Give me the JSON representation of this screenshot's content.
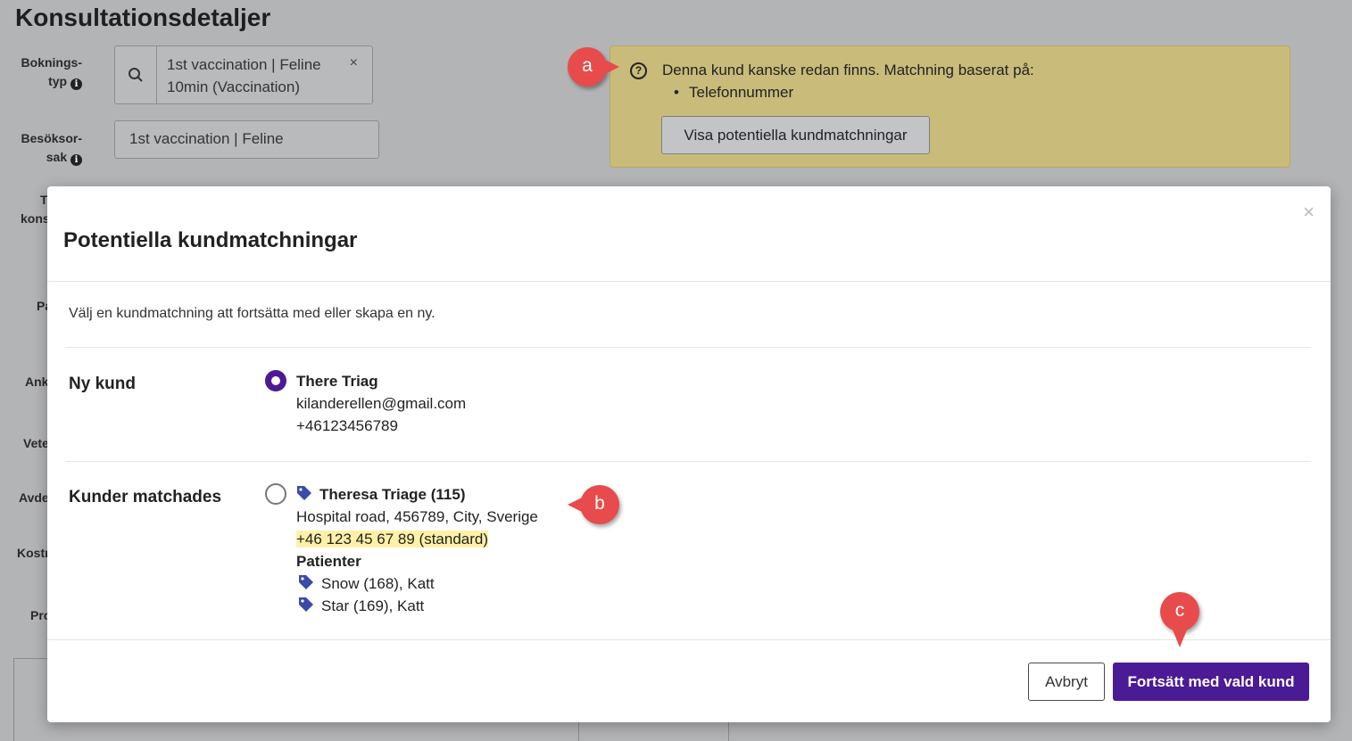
{
  "page": {
    "title": "Konsultationsdetaljer",
    "booking_type_label": [
      "Boknings-",
      "typ"
    ],
    "booking_type_value": [
      "1st vaccination | Feline",
      "10min (Vaccination)"
    ],
    "visit_reason_label": [
      "Besöksor-",
      "sak"
    ],
    "visit_reason_value": "1st vaccination | Feline",
    "cut_labels": [
      "T",
      "kons",
      "Pa",
      "Ank",
      "Vete",
      "Avde",
      "Kostr",
      "Pro"
    ]
  },
  "warning": {
    "text": "Denna kund kanske redan finns. Matchning baserat på:",
    "bullet": "Telefonnummer",
    "button": "Visa potentiella kundmatchningar"
  },
  "callouts": {
    "a": "a",
    "b": "b",
    "c": "c"
  },
  "modal": {
    "title": "Potentiella kundmatchningar",
    "close": "×",
    "intro": "Välj en kundmatchning att fortsätta med eller skapa en ny.",
    "new_customer": {
      "label": "Ny kund",
      "name": "There Triag",
      "email": "kilanderellen@gmail.com",
      "phone": "+46123456789",
      "selected": true
    },
    "matched": {
      "label": "Kunder matchades",
      "name": "Theresa Triage (115)",
      "address": "Hospital road, 456789, City, Sverige",
      "phone": "+46 123 45 67 89 (standard)",
      "patients_heading": "Patienter",
      "patients": [
        "Snow (168), Katt",
        "Star (169), Katt"
      ],
      "selected": false
    },
    "cancel": "Avbryt",
    "continue": "Fortsätt med vald kund"
  },
  "colors": {
    "primary": "#4b1a95",
    "warning_bg": "#c9bb7a",
    "highlight": "#fdf1a8",
    "callout": "#e84b4b",
    "tag": "#3b4aa8"
  }
}
